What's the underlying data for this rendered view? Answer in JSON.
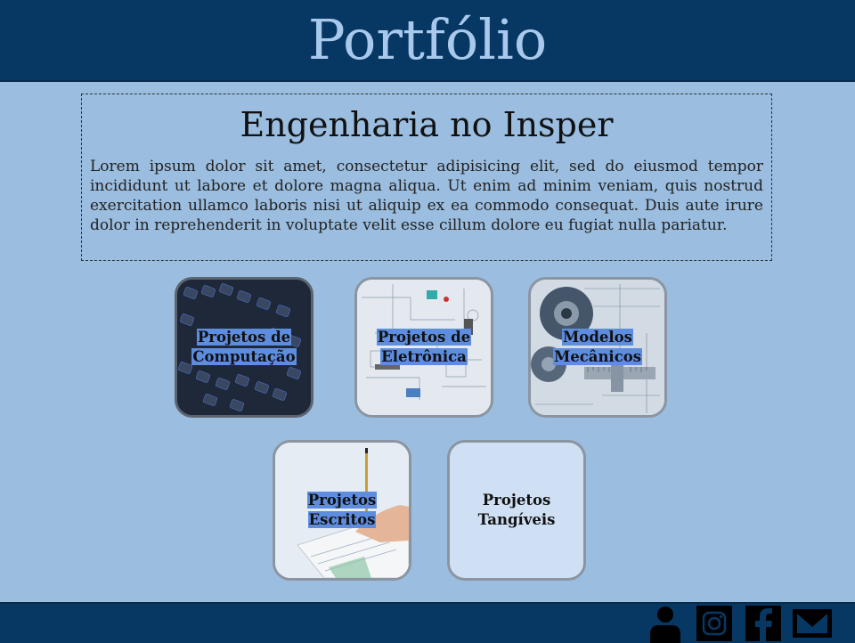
{
  "header": {
    "title": "Portfólio"
  },
  "intro": {
    "heading": "Engenharia no Insper",
    "body": "Lorem ipsum dolor sit amet, consectetur adipisicing elit, sed do eiusmod tempor incididunt ut labore et dolore magna aliqua. Ut enim ad minim veniam, quis nostrud exercitation ullamco laboris nisi ut aliquip ex ea commodo consequat. Duis aute irure dolor in reprehenderit in voluptate velit esse cillum dolore eu fugiat nulla pariatur."
  },
  "cards": [
    {
      "line1": "Projetos de",
      "line2": "Computação"
    },
    {
      "line1": "Projetos de",
      "line2": "Eletrônica"
    },
    {
      "line1": "Modelos",
      "line2": "Mecânicos"
    },
    {
      "line1": "Projetos",
      "line2": "Escritos"
    },
    {
      "line1": "Projetos",
      "line2": "Tangíveis"
    }
  ],
  "footer": {
    "icons": [
      "person-icon",
      "instagram-icon",
      "facebook-icon",
      "mail-icon"
    ]
  },
  "colors": {
    "header_bg": "#073863",
    "page_bg": "#9bbddf",
    "title_text": "#a9c9ec",
    "label_highlight": "#5e8de0"
  }
}
